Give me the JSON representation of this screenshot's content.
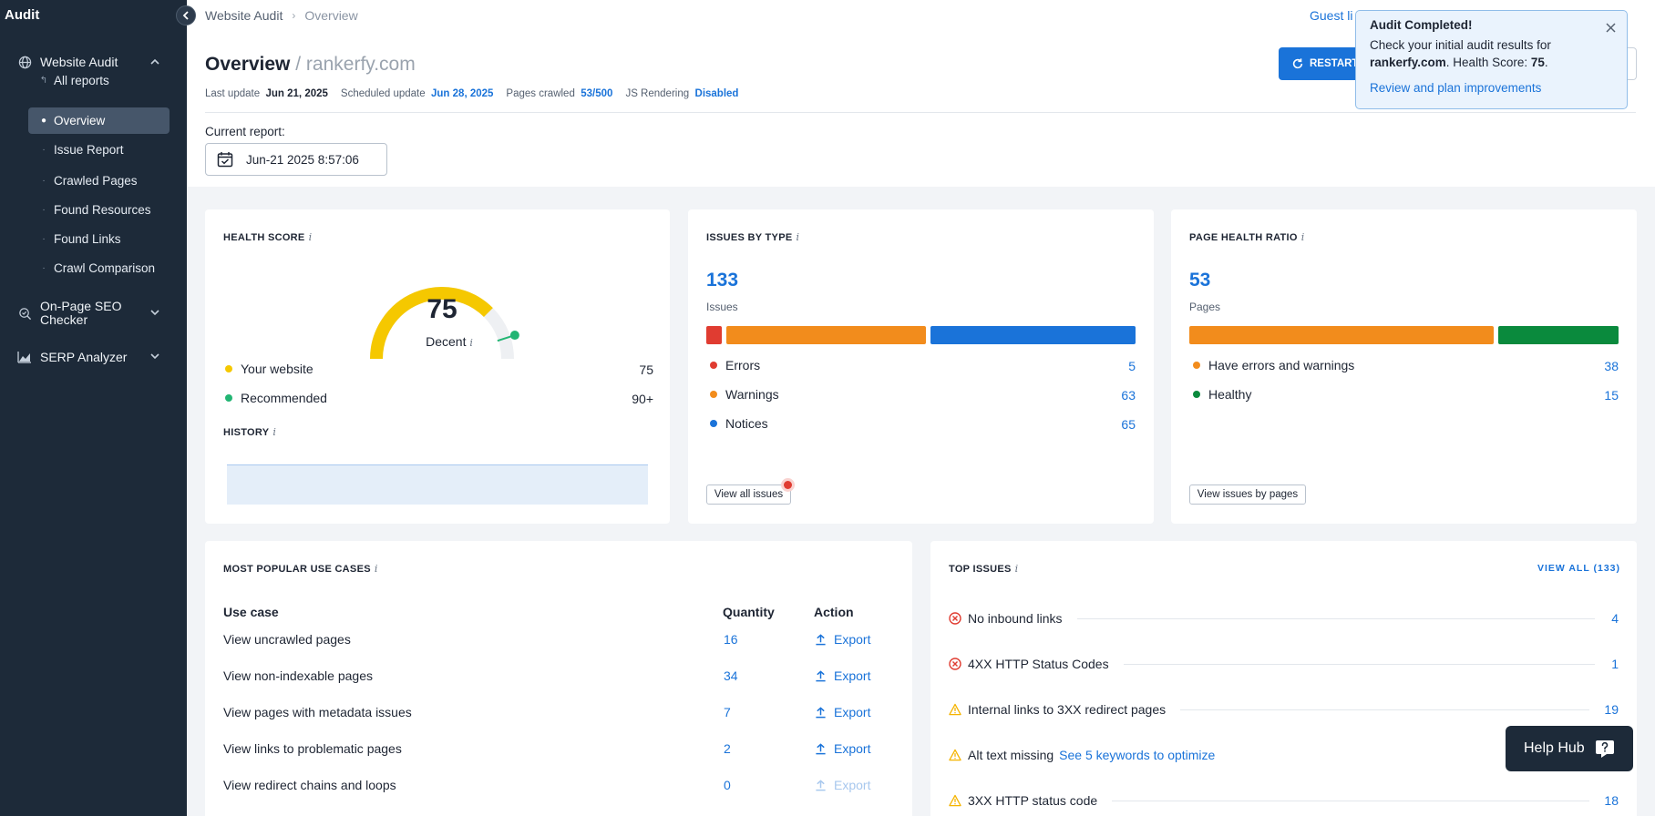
{
  "sidebar": {
    "title": "Audit",
    "groups": [
      {
        "label": "Website Audit",
        "icon": "globe-icon"
      },
      {
        "label": "On-Page SEO Checker",
        "icon": "search-check-icon"
      },
      {
        "label": "SERP Analyzer",
        "icon": "chart-mountain-icon"
      }
    ],
    "items": [
      {
        "label": "All reports"
      },
      {
        "label": "Overview"
      },
      {
        "label": "Issue Report"
      },
      {
        "label": "Crawled Pages"
      },
      {
        "label": "Found Resources"
      },
      {
        "label": "Found Links"
      },
      {
        "label": "Crawl Comparison"
      }
    ]
  },
  "header": {
    "breadcrumb": [
      "Website Audit",
      "Overview"
    ],
    "guest_link": "Guest li",
    "title": "Overview",
    "domain": "/ rankerfy.com",
    "restart_label": "RESTART",
    "meta": {
      "last_update_label": "Last update",
      "last_update": "Jun 21, 2025",
      "scheduled_label": "Scheduled update",
      "scheduled": "Jun 28, 2025",
      "pages_label": "Pages crawled",
      "pages": "53/500",
      "js_label": "JS Rendering",
      "js": "Disabled"
    },
    "current_report_label": "Current report:",
    "current_report": "Jun-21 2025 8:57:06"
  },
  "toast": {
    "title": "Audit Completed!",
    "line1": "Check your initial audit results for",
    "domain": "rankerfy.com",
    "line2_mid": ". Health Score: ",
    "score": "75",
    "line2_end": ".",
    "link": "Review and plan improvements"
  },
  "health": {
    "title": "HEALTH SCORE",
    "info": "i",
    "score": "75",
    "score_value": 75,
    "rating": "Decent",
    "legend": [
      {
        "label": "Your website",
        "value": "75",
        "color": "#f5c800"
      },
      {
        "label": "Recommended",
        "value": "90+",
        "color": "#22b573"
      }
    ],
    "history_title": "HISTORY"
  },
  "issues_by_type": {
    "title": "ISSUES BY TYPE",
    "total": "133",
    "sub": "Issues",
    "bars": [
      {
        "value": 5,
        "color": "#e03c31"
      },
      {
        "value": 63,
        "color": "#f28c1c"
      },
      {
        "value": 65,
        "color": "#1a73d9"
      }
    ],
    "legend": [
      {
        "label": "Errors",
        "value": "5",
        "color": "#e03c31"
      },
      {
        "label": "Warnings",
        "value": "63",
        "color": "#f28c1c"
      },
      {
        "label": "Notices",
        "value": "65",
        "color": "#1a73d9"
      }
    ],
    "button": "View all issues"
  },
  "page_health": {
    "title": "PAGE HEALTH RATIO",
    "total": "53",
    "sub": "Pages",
    "bars": [
      {
        "value": 38,
        "color": "#f28c1c"
      },
      {
        "value": 15,
        "color": "#0a8a3d"
      }
    ],
    "legend": [
      {
        "label": "Have errors and warnings",
        "value": "38",
        "color": "#f28c1c"
      },
      {
        "label": "Healthy",
        "value": "15",
        "color": "#0a8a3d"
      }
    ],
    "button": "View issues by pages"
  },
  "use_cases": {
    "title": "MOST POPULAR USE CASES",
    "headers": [
      "Use case",
      "Quantity",
      "Action"
    ],
    "rows": [
      {
        "label": "View uncrawled pages",
        "qty": "16",
        "action": "Export",
        "disabled": false
      },
      {
        "label": "View non-indexable pages",
        "qty": "34",
        "action": "Export",
        "disabled": false
      },
      {
        "label": "View pages with metadata issues",
        "qty": "7",
        "action": "Export",
        "disabled": false
      },
      {
        "label": "View links to problematic pages",
        "qty": "2",
        "action": "Export",
        "disabled": false
      },
      {
        "label": "View redirect chains and loops",
        "qty": "0",
        "action": "Export",
        "disabled": true
      }
    ]
  },
  "top_issues": {
    "title": "TOP ISSUES",
    "view_all": "VIEW ALL (133)",
    "rows": [
      {
        "label": "No inbound links",
        "value": "4",
        "severity": "error",
        "link": ""
      },
      {
        "label": "4XX HTTP Status Codes",
        "value": "1",
        "severity": "error",
        "link": ""
      },
      {
        "label": "Internal links to 3XX redirect pages",
        "value": "19",
        "severity": "warning",
        "link": ""
      },
      {
        "label": "Alt text missing",
        "value": "",
        "severity": "warning",
        "link": "See 5 keywords to optimize"
      },
      {
        "label": "3XX HTTP status code",
        "value": "18",
        "severity": "warning",
        "link": ""
      }
    ]
  },
  "help_hub": {
    "label": "Help Hub"
  },
  "colors": {
    "accent": "#1a73d9",
    "sidebar": "#1d2a39",
    "gauge": "#f5c800",
    "recommended": "#22b573"
  }
}
